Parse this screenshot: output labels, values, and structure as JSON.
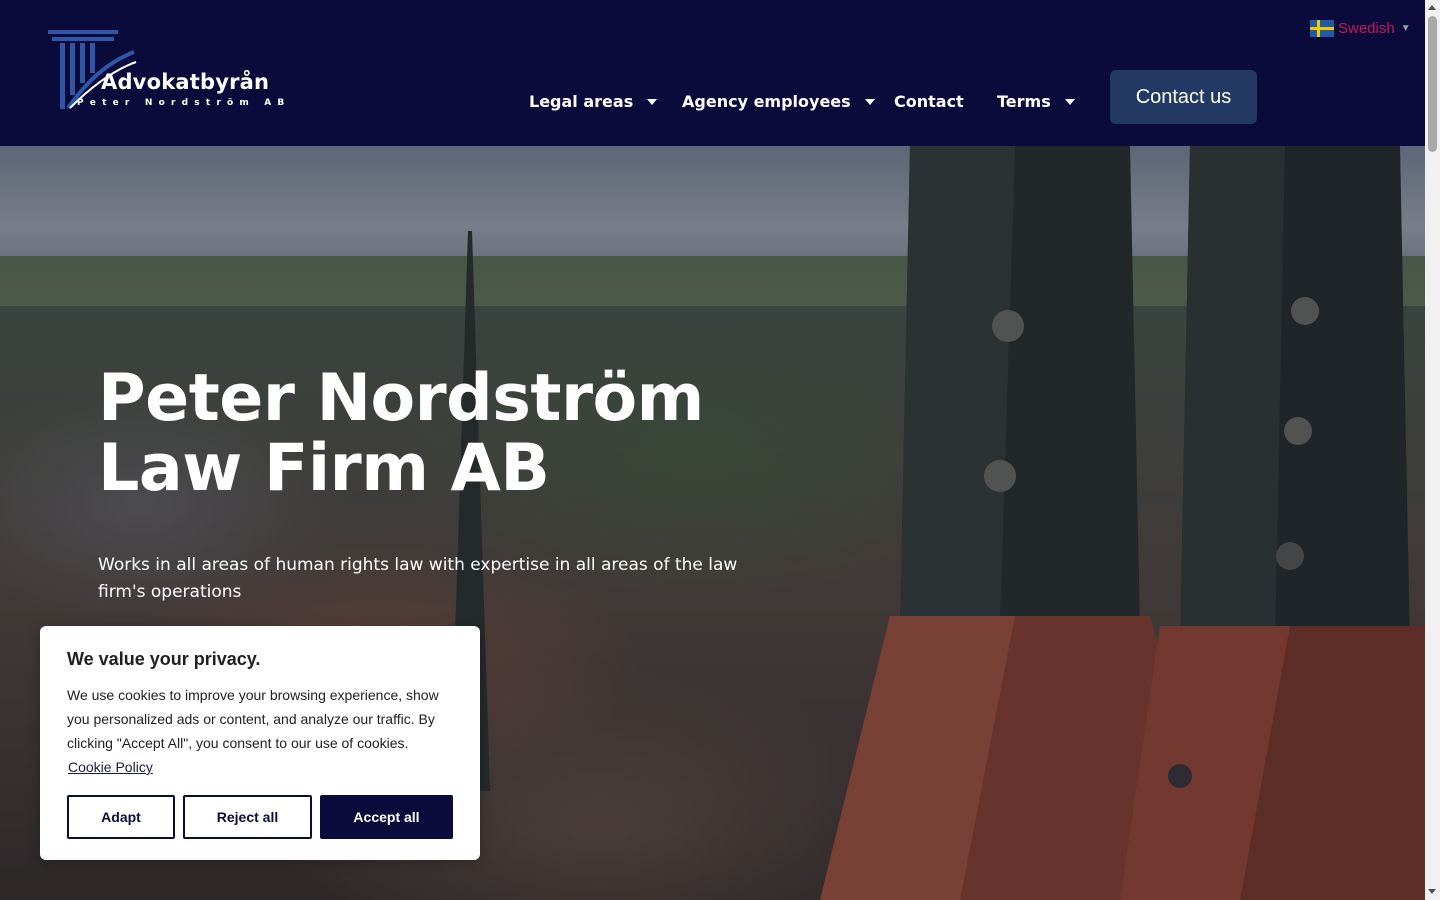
{
  "brand": {
    "name": "Advokatbyrån",
    "tagline": "Peter Nordström AB"
  },
  "nav": {
    "items": [
      {
        "label": "Legal areas",
        "has_dropdown": true
      },
      {
        "label": "Agency employees",
        "has_dropdown": true
      },
      {
        "label": "Contact",
        "has_dropdown": false
      },
      {
        "label": "Terms",
        "has_dropdown": true
      }
    ],
    "cta_label": "Contact us"
  },
  "language": {
    "selected": "Swedish",
    "flag_icon": "sweden-flag-icon"
  },
  "hero": {
    "title_line1": "Peter Nordström",
    "title_line2": "Law Firm AB",
    "subtitle": "Works in all areas of human rights law with expertise in all areas of the law firm's operations"
  },
  "cookie": {
    "title": "We value your privacy.",
    "text": "We use cookies to improve your browsing experience, show you personalized ads or content, and analyze our traffic. By clicking \"Accept All\", you consent to our use of cookies.",
    "policy_link": "Cookie Policy",
    "buttons": {
      "adapt": "Adapt",
      "reject": "Reject all",
      "accept": "Accept all"
    }
  },
  "colors": {
    "header_bg": "#0b0b3b",
    "cta_bg": "#223a63",
    "language_text": "#c2185b"
  }
}
